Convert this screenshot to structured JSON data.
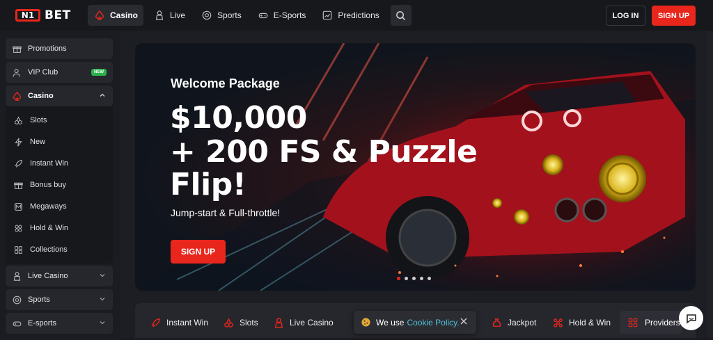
{
  "brand": {
    "mark": "N1",
    "name": "BET"
  },
  "nav": [
    {
      "label": "Casino",
      "icon": "spade-icon",
      "active": true
    },
    {
      "label": "Live",
      "icon": "dealer-icon",
      "active": false
    },
    {
      "label": "Sports",
      "icon": "soccer-ball-icon",
      "active": false
    },
    {
      "label": "E-Sports",
      "icon": "gamepad-icon",
      "active": false
    },
    {
      "label": "Predictions",
      "icon": "chart-icon",
      "active": false
    }
  ],
  "auth": {
    "login": "LOG IN",
    "signup": "SIGN UP"
  },
  "sidebar": {
    "promotions": "Promotions",
    "vip": "VIP Club",
    "vip_badge": "NEW",
    "casino": "Casino",
    "casino_items": [
      "Slots",
      "New",
      "Instant Win",
      "Bonus buy",
      "Megaways",
      "Hold & Win",
      "Collections"
    ],
    "live_casino": "Live Casino",
    "sports": "Sports",
    "esports": "E-sports"
  },
  "hero": {
    "welcome": "Welcome Package",
    "amount": "$10,000",
    "line2": "+ 200 FS & Puzzle",
    "line3": "Flip!",
    "tagline": "Jump-start & Full-throttle!",
    "cta": "SIGN UP",
    "slides": 5,
    "active_slide": 1
  },
  "categories": [
    "Instant Win",
    "Slots",
    "Live Casino",
    "Jackpot",
    "Hold & Win",
    "Providers"
  ],
  "cookie": {
    "text": "We use",
    "link": "Cookie Policy."
  },
  "colors": {
    "accent": "#e8261c",
    "bg": "#1b1c21",
    "panel": "#26272d",
    "link": "#4fc3d9",
    "badge": "#2bb24c"
  }
}
